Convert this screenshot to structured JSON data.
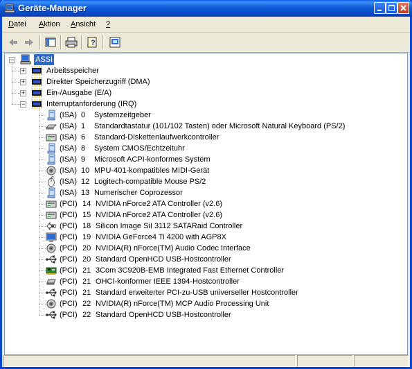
{
  "window": {
    "title": "Geräte-Manager"
  },
  "menu": [
    {
      "label": "Datei",
      "accel": "D"
    },
    {
      "label": "Aktion",
      "accel": "A"
    },
    {
      "label": "Ansicht",
      "accel": "A"
    },
    {
      "label": "?",
      "accel": "?"
    }
  ],
  "tree": {
    "root": "ASSI",
    "categories": [
      {
        "label": "Arbeitsspeicher",
        "expanded": false
      },
      {
        "label": "Direkter Speicherzugriff (DMA)",
        "expanded": false
      },
      {
        "label": "Ein-/Ausgabe (E/A)",
        "expanded": false
      },
      {
        "label": "Interruptanforderung (IRQ)",
        "expanded": true
      }
    ],
    "irq": [
      {
        "bus": "(ISA)",
        "num": "0",
        "name": "Systemzeitgeber",
        "icon": "system-icon"
      },
      {
        "bus": "(ISA)",
        "num": "1",
        "name": "Standardtastatur (101/102 Tasten) oder Microsoft Natural Keyboard (PS/2)",
        "icon": "keyboard-icon"
      },
      {
        "bus": "(ISA)",
        "num": "6",
        "name": "Standard-Diskettenlaufwerkcontroller",
        "icon": "drive-controller-icon"
      },
      {
        "bus": "(ISA)",
        "num": "8",
        "name": "System CMOS/Echtzeituhr",
        "icon": "system-icon"
      },
      {
        "bus": "(ISA)",
        "num": "9",
        "name": "Microsoft ACPI-konformes System",
        "icon": "system-icon"
      },
      {
        "bus": "(ISA)",
        "num": "10",
        "name": "MPU-401-kompatibles MIDI-Gerät",
        "icon": "speaker-icon"
      },
      {
        "bus": "(ISA)",
        "num": "12",
        "name": "Logitech-compatible Mouse PS/2",
        "icon": "mouse-icon"
      },
      {
        "bus": "(ISA)",
        "num": "13",
        "name": "Numerischer Coprozessor",
        "icon": "system-icon"
      },
      {
        "bus": "(PCI)",
        "num": "14",
        "name": "NVIDIA nForce2 ATA Controller (v2.6)",
        "icon": "drive-controller-icon"
      },
      {
        "bus": "(PCI)",
        "num": "15",
        "name": "NVIDIA nForce2 ATA Controller (v2.6)",
        "icon": "drive-controller-icon"
      },
      {
        "bus": "(PCI)",
        "num": "18",
        "name": "Silicon Image SiI 3112 SATARaid Controller",
        "icon": "scsi-icon"
      },
      {
        "bus": "(PCI)",
        "num": "19",
        "name": "NVIDIA GeForce4 Ti 4200 with AGP8X",
        "icon": "display-icon"
      },
      {
        "bus": "(PCI)",
        "num": "20",
        "name": "NVIDIA(R) nForce(TM) Audio Codec Interface",
        "icon": "speaker-icon"
      },
      {
        "bus": "(PCI)",
        "num": "20",
        "name": "Standard OpenHCD USB-Hostcontroller",
        "icon": "usb-icon"
      },
      {
        "bus": "(PCI)",
        "num": "21",
        "name": "3Com 3C920B-EMB Integrated Fast Ethernet Controller",
        "icon": "network-card-icon"
      },
      {
        "bus": "(PCI)",
        "num": "21",
        "name": "OHCI-konformer IEEE 1394-Hostcontroller",
        "icon": "firewire-icon"
      },
      {
        "bus": "(PCI)",
        "num": "21",
        "name": "Standard erweiterter PCI-zu-USB universeller Hostcontroller",
        "icon": "usb-icon"
      },
      {
        "bus": "(PCI)",
        "num": "22",
        "name": "NVIDIA(R) nForce(TM) MCP Audio Processing Unit",
        "icon": "speaker-icon"
      },
      {
        "bus": "(PCI)",
        "num": "22",
        "name": "Standard OpenHCD USB-Hostcontroller",
        "icon": "usb-icon"
      }
    ]
  },
  "colors": {
    "titlebar": "#0a5fe8",
    "selection": "#316ac5"
  }
}
